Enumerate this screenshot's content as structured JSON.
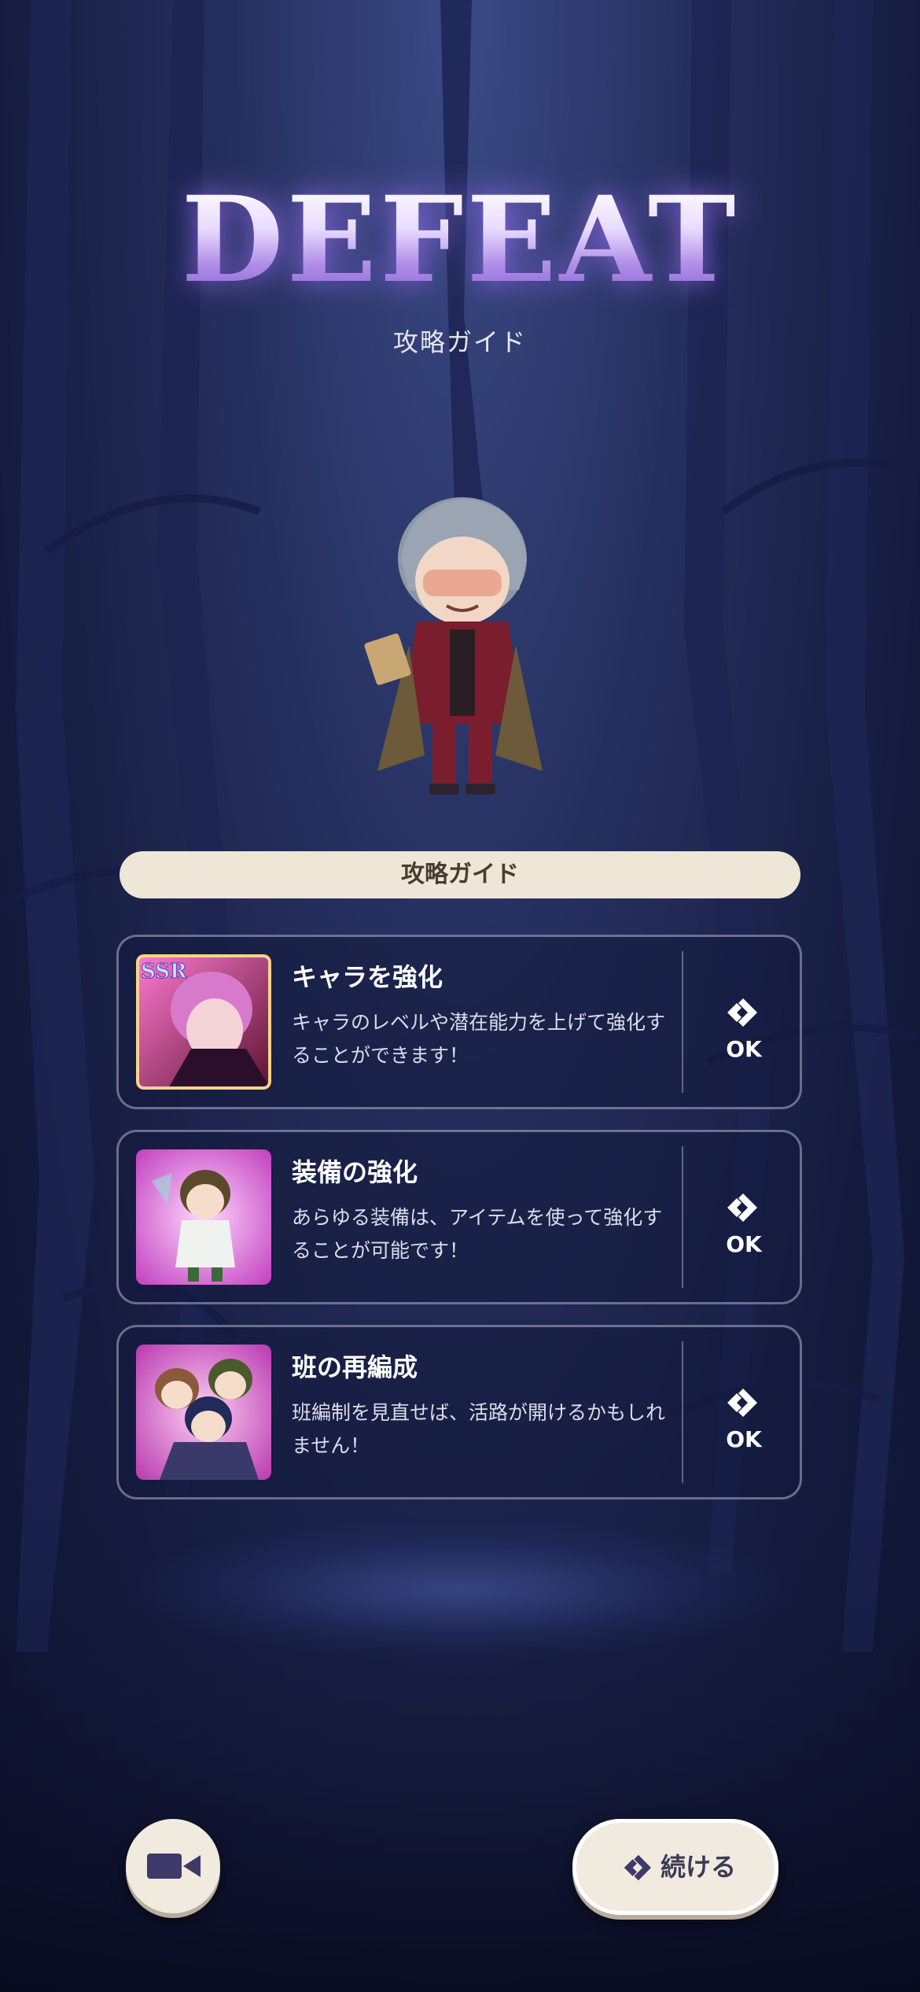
{
  "header": {
    "title": "DEFEAT",
    "subtitle": "攻略ガイド"
  },
  "guide": {
    "heading": "攻略ガイド",
    "items": [
      {
        "title": "キャラを強化",
        "description": "キャラのレベルや潜在能力を上げて強化することができます！",
        "badge": "SSR",
        "action": "OK"
      },
      {
        "title": "装備の強化",
        "description": "あらゆる装備は、アイテムを使って強化することが可能です！",
        "action": "OK"
      },
      {
        "title": "班の再編成",
        "description": "班編制を見直せば、活路が開けるかもしれません！",
        "action": "OK"
      }
    ]
  },
  "footer": {
    "video_icon": "video-camera-icon",
    "continue_label": "続ける"
  },
  "colors": {
    "accent": "#8a63d8",
    "button_bg": "#f1eadf",
    "header_bar": "#eee6d6"
  }
}
